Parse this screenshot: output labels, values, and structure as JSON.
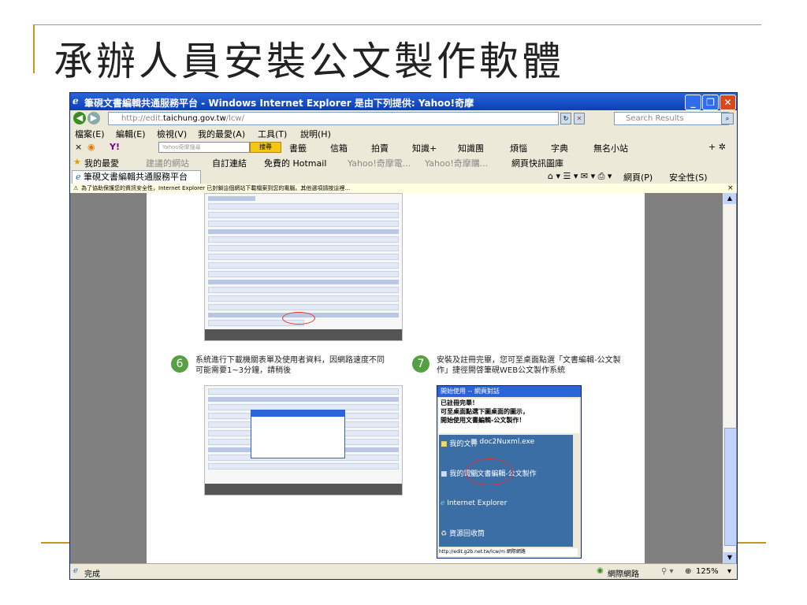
{
  "slide": {
    "title": "承辦人員安裝公文製作軟體"
  },
  "browser": {
    "title": "筆硯文書編輯共通服務平台 - Windows Internet Explorer 是由下列提供: Yahoo!奇摩",
    "address_prefix": "http://edit.",
    "address_domain": "taichung.gov.tw",
    "address_suffix": "/lcw/",
    "search_placeholder": "Search Results",
    "menu": [
      "檔案(E)",
      "編輯(E)",
      "檢視(V)",
      "我的最愛(A)",
      "工具(T)",
      "說明(H)"
    ],
    "yahoo_toolbar": {
      "search_placeholder": "Yahoo奇摩搜尋",
      "search_button": "搜尋",
      "items": [
        "書籤",
        "信箱",
        "拍賣",
        "知識+",
        "知識團",
        "煩惱",
        "字典",
        "無名小站"
      ]
    },
    "favorites_bar": {
      "label": "我的最愛",
      "items": [
        "建議的網站",
        "自訂連結",
        "免費的 Hotmail",
        "Yahoo!奇摩電...",
        "Yahoo!奇摩購...",
        "網頁快訊圖庫"
      ]
    },
    "tab_label": "筆硯文書編輯共通服務平台",
    "command_bar": [
      "網頁(P)",
      "安全性(S)"
    ],
    "info_bar": "為了協助保護您的資訊安全性，Internet Explorer 已封鎖這個網站下載檔案到您的電腦。其他選項請按這裡...",
    "status": {
      "left": "完成",
      "zone": "網際網路",
      "zoom": "125%"
    }
  },
  "steps": [
    {
      "number": "6",
      "text": "系統進行下載機關表單及使用者資料，因網路速度不同可能需要1~3分鐘，請稍後"
    },
    {
      "number": "7",
      "text": "安裝及註冊完畢，您可至桌面點選「文書編輯-公文製作」捷徑開啓筆硯WEB公文製作系統"
    }
  ],
  "dialog_7": {
    "title": "開始使用 -- 網頁對話",
    "message_lines": [
      "已註冊完畢！",
      "可至桌面點選下圖桌面的圖示，",
      "開始使用文書編輯-公文製作！"
    ],
    "icons": [
      "我的文件",
      "doc2Nuxml.exe",
      "我的電腦",
      "文書編輯-公文製作",
      "Internet Explorer",
      "資源回收筒"
    ],
    "footer": "http://edit.g2b.net.tw/lcw/m 網際網路"
  },
  "colors": {
    "accent_rule": "#c8961e",
    "titlebar": "#0a3fb8",
    "step_badge": "#55a043"
  }
}
